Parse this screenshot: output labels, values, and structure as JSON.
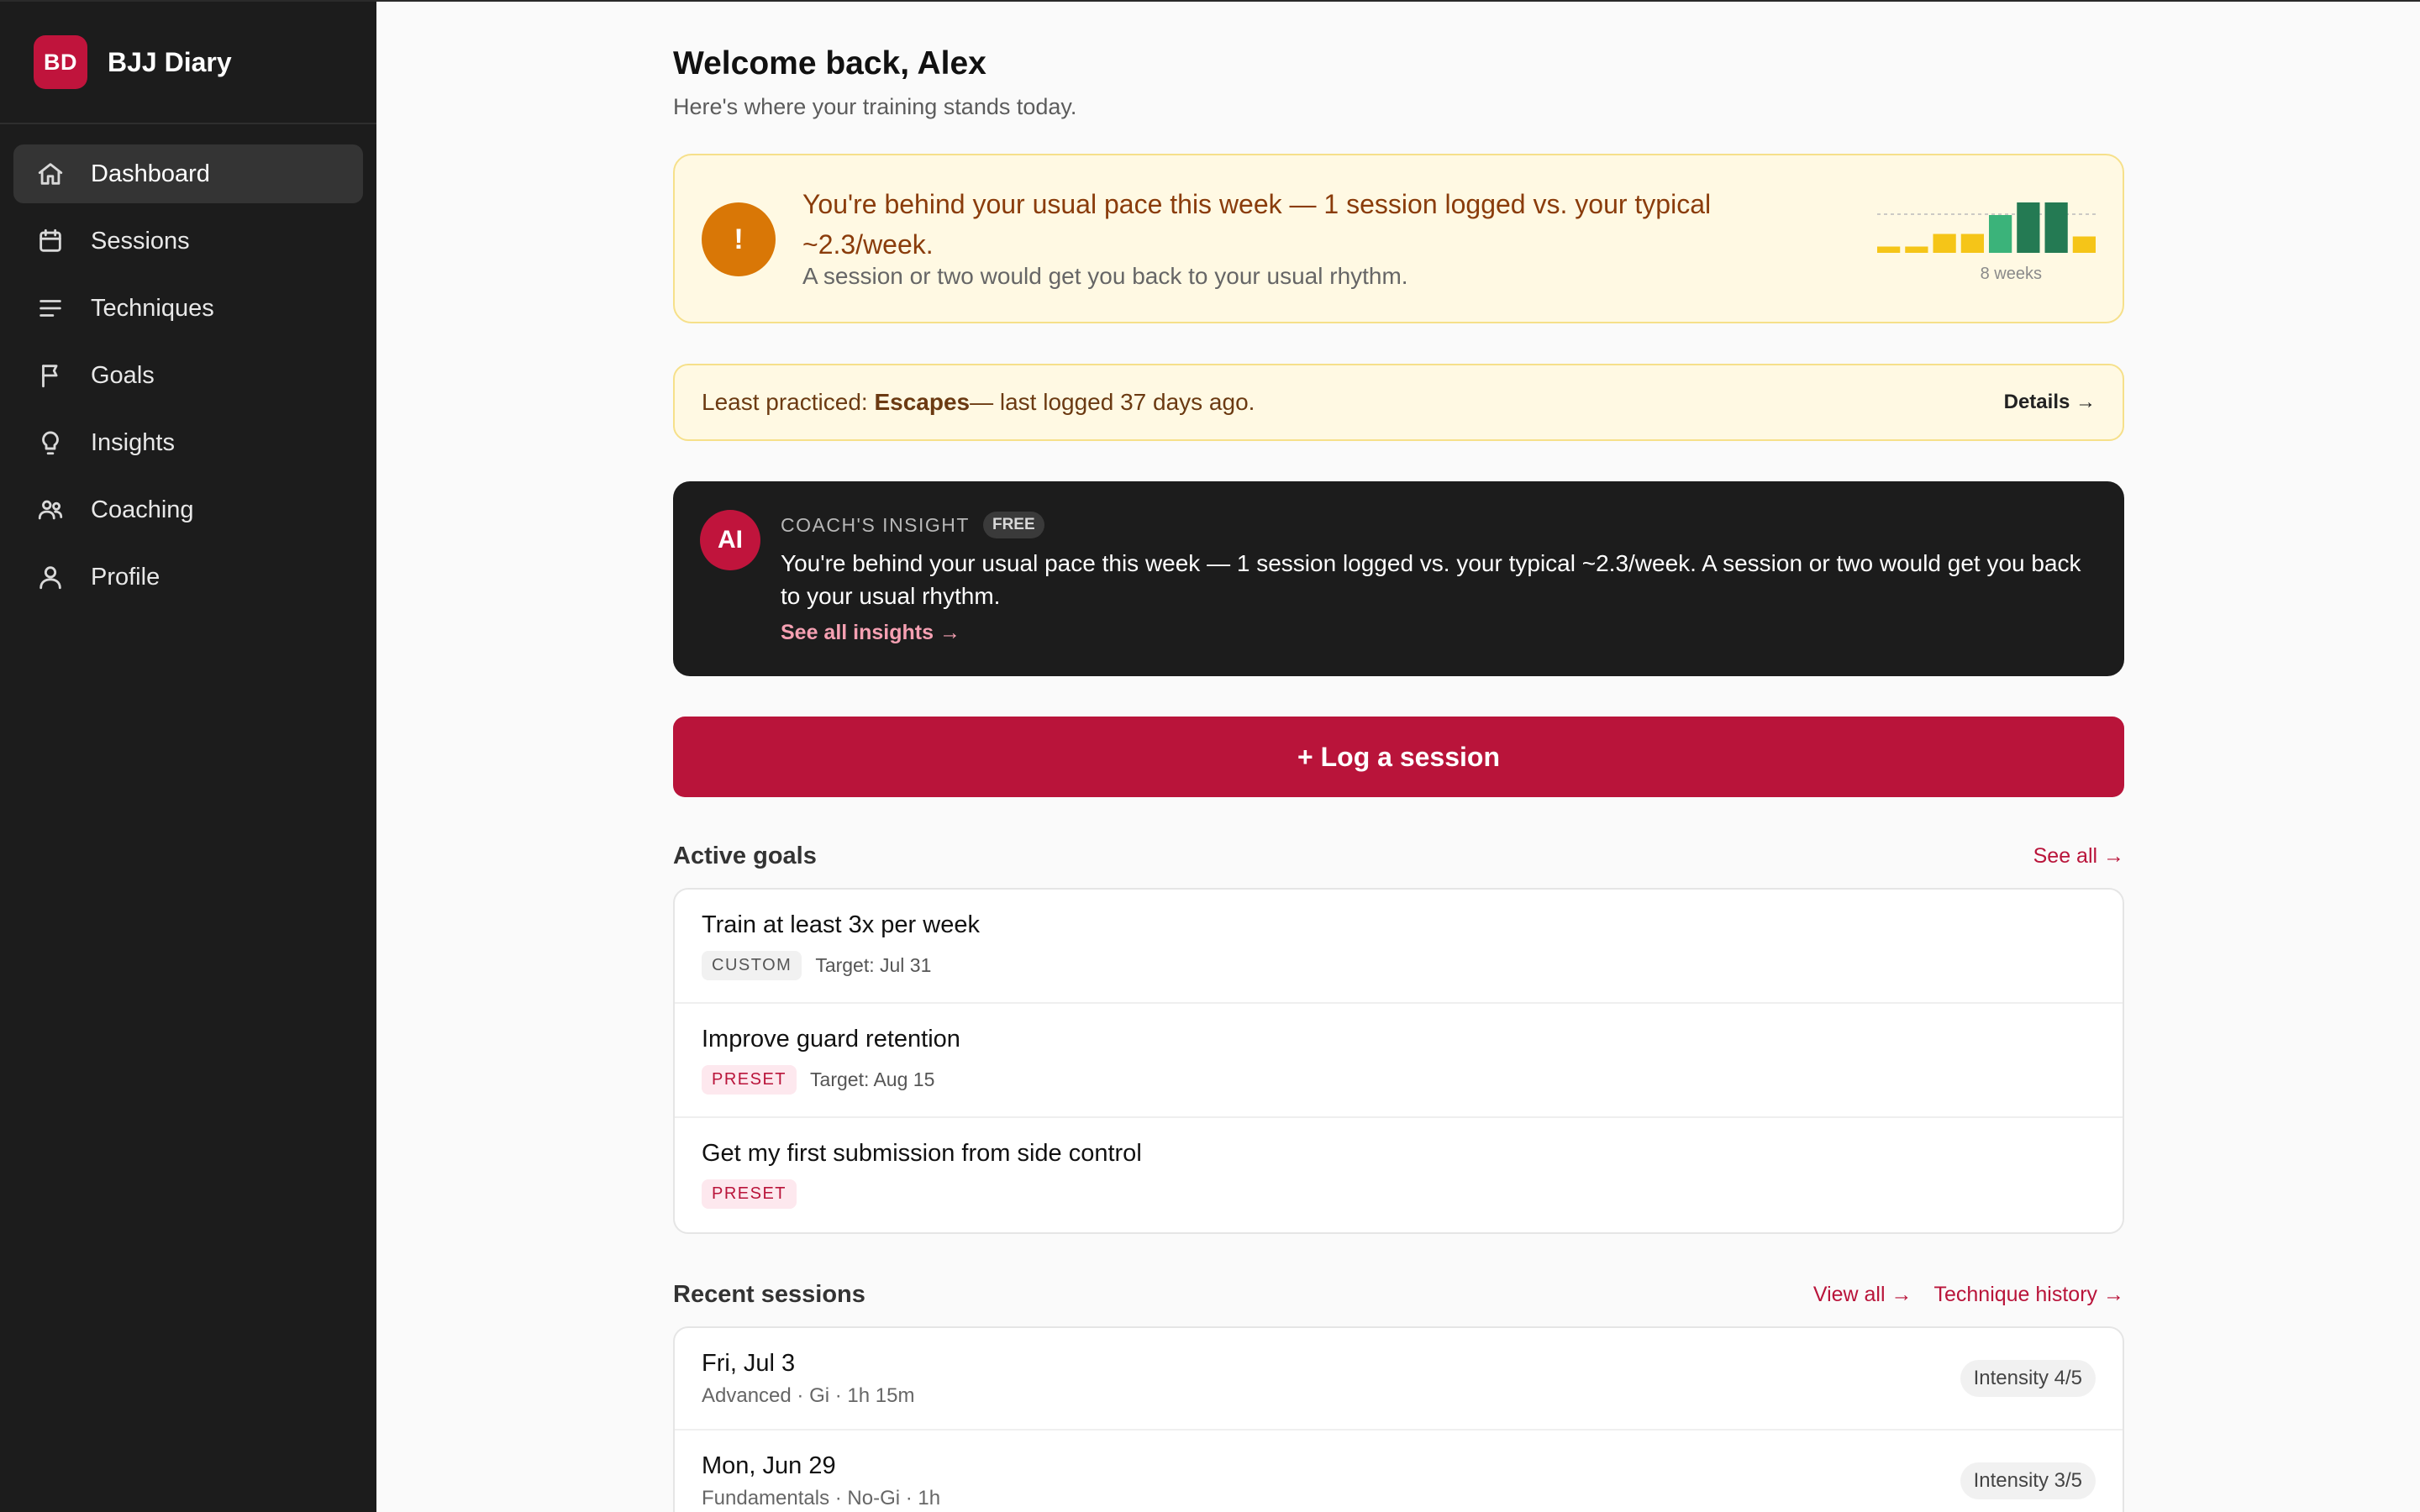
{
  "brand": {
    "initials": "BD",
    "name": "BJJ Diary"
  },
  "nav": [
    {
      "label": "Dashboard",
      "icon": "home-icon"
    },
    {
      "label": "Sessions",
      "icon": "calendar-icon"
    },
    {
      "label": "Techniques",
      "icon": "list-icon"
    },
    {
      "label": "Goals",
      "icon": "flag-icon"
    },
    {
      "label": "Insights",
      "icon": "lightbulb-icon"
    },
    {
      "label": "Coaching",
      "icon": "people-icon"
    },
    {
      "label": "Profile",
      "icon": "user-icon"
    }
  ],
  "welcome": {
    "title": "Welcome back, Alex",
    "subtitle": "Here's where your training stands today."
  },
  "pace": {
    "icon": "!",
    "title": "You're behind your usual pace this week — 1 session logged vs. your typical ~2.3/week.",
    "subtitle": "A session or two would get you back to your usual rhythm.",
    "spark_label": "8 weeks",
    "spark_values": [
      0.5,
      0.5,
      1.5,
      1.5,
      3,
      4,
      4,
      1.3
    ],
    "spark_colors": [
      "#f5c518",
      "#f5c518",
      "#f5c518",
      "#f5c518",
      "#3bb37a",
      "#247a53",
      "#247a53",
      "#f5c518"
    ]
  },
  "least": {
    "prefix": "Least practiced: ",
    "technique": "Escapes",
    "suffix": " — last logged 37 days ago.",
    "link": "Details →"
  },
  "insight": {
    "badge": "AI",
    "kicker": "COACH'S INSIGHT",
    "tier": "FREE",
    "text": "You're behind your usual pace this week — 1 session logged vs. your typical ~2.3/week. A session or two would get you back to your usual rhythm.",
    "link": "See all insights →"
  },
  "log_button": "+ Log a session",
  "goals": {
    "title": "Active goals",
    "link": "See all →",
    "items": [
      {
        "title": "Train at least 3x per week",
        "tag": "CUSTOM",
        "target": "Target: Jul 31"
      },
      {
        "title": "Improve guard retention",
        "tag": "PRESET",
        "target": "Target: Aug 15"
      },
      {
        "title": "Get my first submission from side control",
        "tag": "PRESET",
        "target": ""
      }
    ]
  },
  "recent": {
    "title": "Recent sessions",
    "link_view_all": "View all →",
    "link_history": "Technique history →",
    "items": [
      {
        "date": "Fri, Jul 3",
        "meta": "Advanced · Gi · 1h 15m",
        "intensity": "Intensity 4/5"
      },
      {
        "date": "Mon, Jun 29",
        "meta": "Fundamentals · No-Gi · 1h",
        "intensity": "Intensity 3/5"
      }
    ]
  }
}
